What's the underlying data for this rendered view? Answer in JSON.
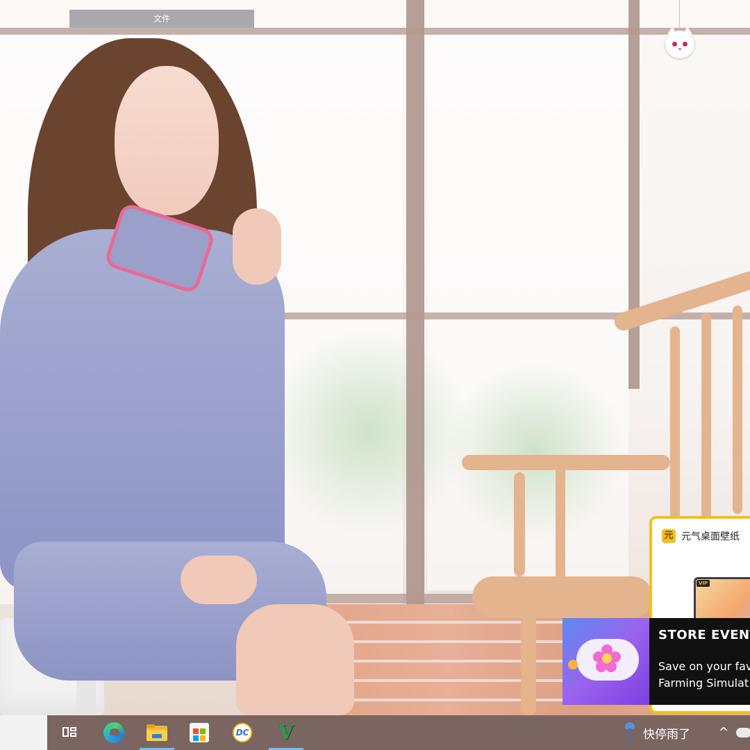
{
  "desktop": {
    "folder_label": "文件"
  },
  "notifications": {
    "wallpaper_app": {
      "logo_char": "元",
      "title": "元气桌面壁纸",
      "badge": "VIP",
      "border_color": "#f3c01c"
    },
    "store_event": {
      "title": "STORE EVENT",
      "body_line1": "Save on your fav",
      "body_line2": "Farming Simulat"
    }
  },
  "taskbar": {
    "icons": [
      {
        "name": "task-view-icon",
        "active": false
      },
      {
        "name": "edge-icon",
        "active": false
      },
      {
        "name": "file-explorer-icon",
        "active": true
      },
      {
        "name": "microsoft-store-icon",
        "active": false
      },
      {
        "name": "dc-app-icon",
        "label": "DC",
        "active": false
      },
      {
        "name": "v-app-icon",
        "label": "V",
        "active": true
      }
    ],
    "weather_text": "快停雨了",
    "tray_chevron": "^",
    "background_color": "#7a6560",
    "active_indicator_color": "#7cb9ef"
  }
}
